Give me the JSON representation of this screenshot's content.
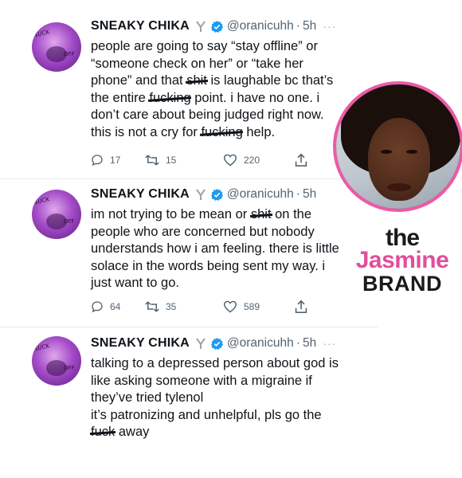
{
  "tweets": [
    {
      "avatar_text1": "LUCK",
      "avatar_text2": "OFF",
      "name": "SNEAKY CHIKA",
      "handle": "@oranicuhh",
      "separator": "·",
      "time": "5h",
      "more": "···",
      "lines": [
        {
          "parts": [
            {
              "t": "people are going to say “stay offline” or"
            }
          ]
        },
        {
          "parts": [
            {
              "t": "“someone check on her” or “take her"
            }
          ]
        },
        {
          "parts": [
            {
              "t": "phone” and that "
            },
            {
              "t": "shit",
              "c": true
            },
            {
              "t": " is laughable bc that’s"
            }
          ]
        },
        {
          "parts": [
            {
              "t": "the entire "
            },
            {
              "t": "fucking",
              "c": true
            },
            {
              "t": " point. i have no one. i"
            }
          ]
        },
        {
          "parts": [
            {
              "t": "don’t care about being judged right now."
            }
          ]
        },
        {
          "parts": [
            {
              "t": "this is not a cry for "
            },
            {
              "t": "fucking",
              "c": true
            },
            {
              "t": " help."
            }
          ]
        }
      ],
      "replies": "17",
      "retweets": "15",
      "likes": "220"
    },
    {
      "avatar_text1": "LUCK",
      "avatar_text2": "OFF",
      "name": "SNEAKY CHIKA",
      "handle": "@oranicuhh",
      "separator": "·",
      "time": "5h",
      "more": "",
      "lines": [
        {
          "parts": [
            {
              "t": "im not trying to be mean or "
            },
            {
              "t": "shit",
              "c": true
            },
            {
              "t": " on the"
            }
          ]
        },
        {
          "parts": [
            {
              "t": "people who are concerned but nobody"
            }
          ]
        },
        {
          "parts": [
            {
              "t": "understands how i am feeling. there is little"
            }
          ]
        },
        {
          "parts": [
            {
              "t": "solace in the words being sent my way. i"
            }
          ]
        },
        {
          "parts": [
            {
              "t": "just want to go."
            }
          ]
        }
      ],
      "replies": "64",
      "retweets": "35",
      "likes": "589"
    },
    {
      "avatar_text1": "LUCK",
      "avatar_text2": "OFF",
      "name": "SNEAKY CHIKA",
      "handle": "@oranicuhh",
      "separator": "·",
      "time": "5h",
      "more": "···",
      "lines": [
        {
          "parts": [
            {
              "t": "talking to a depressed person about god is"
            }
          ]
        },
        {
          "parts": [
            {
              "t": "like asking someone with a migraine if"
            }
          ]
        },
        {
          "parts": [
            {
              "t": "they’ve tried tylenol"
            }
          ]
        },
        {
          "parts": [
            {
              "t": " "
            }
          ]
        },
        {
          "parts": [
            {
              "t": "it’s patronizing and unhelpful, pls go the"
            }
          ]
        },
        {
          "parts": [
            {
              "t": "fuck",
              "c": true
            },
            {
              "t": " away"
            }
          ]
        }
      ],
      "replies": "",
      "retweets": "",
      "likes": ""
    }
  ],
  "watermark": {
    "the": "the",
    "jasmine": "Jasmine",
    "brand": "BRAND"
  },
  "colors": {
    "name": "#0f1419",
    "muted": "#536471",
    "verified": "#1d9bf0",
    "brand_pink": "#e24d9b",
    "circle_border": "#ec5aa7"
  },
  "icons": [
    "emoji-icon",
    "verified-badge-icon",
    "reply-icon",
    "retweet-icon",
    "like-icon",
    "share-icon",
    "more-icon"
  ]
}
